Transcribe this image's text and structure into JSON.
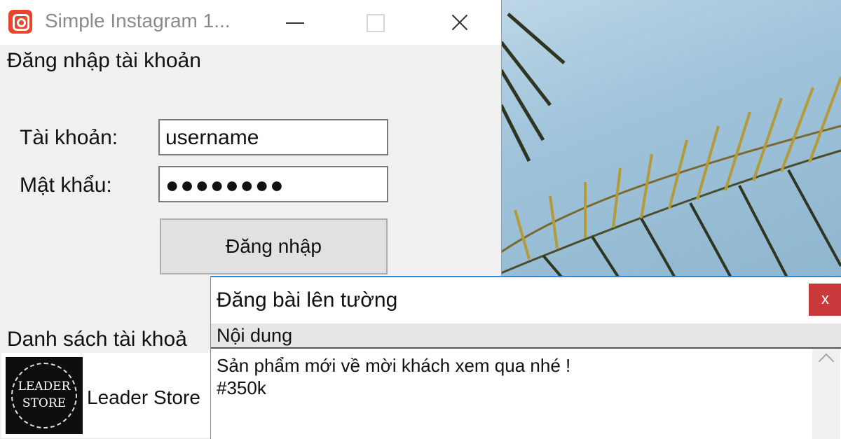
{
  "main_window": {
    "title": "Simple Instagram 1...",
    "login_heading": "Đăng nhập tài khoản",
    "username_label": "Tài khoản:",
    "username_value": "username",
    "password_label": "Mật khẩu:",
    "password_value": "●●●●●●●●",
    "login_button": "Đăng nhập",
    "accounts_heading": "Danh sách tài khoả",
    "accounts": [
      {
        "name": "Leader Store",
        "avatar_text_line1": "LEADER",
        "avatar_text_line2": "STORE"
      }
    ]
  },
  "post_dialog": {
    "title": "Đăng bài lên tường",
    "close_label": "x",
    "content_label": "Nội dung",
    "content_text": "Sản phẩm mới về mời khách xem qua nhé !\n#350k"
  },
  "colors": {
    "app_icon": "#e8452c",
    "dialog_accent": "#2a8dd4",
    "dialog_close": "#c9393c"
  }
}
